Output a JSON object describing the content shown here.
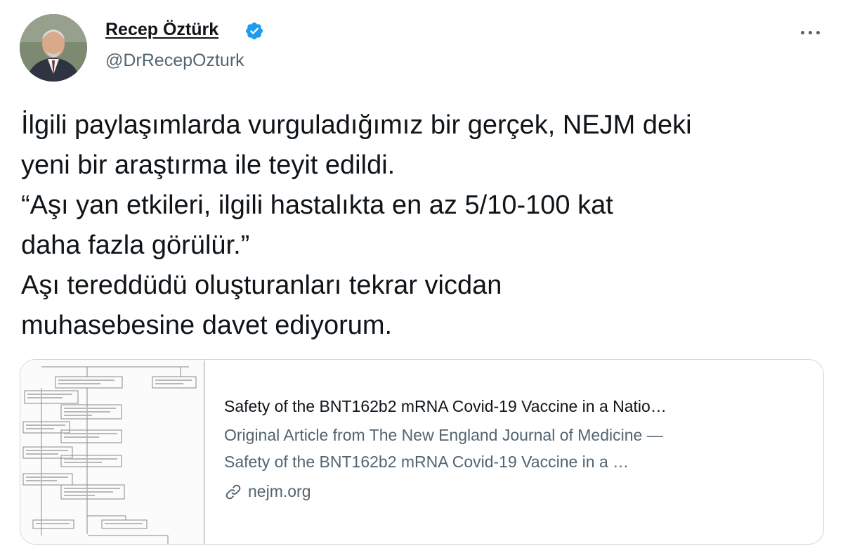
{
  "author": {
    "name": "Recep Öztürk",
    "handle": "@DrRecepOzturk",
    "verified": true,
    "avatar_icon": "profile-photo"
  },
  "menu": {
    "icon": "more-options-icon"
  },
  "tweet": {
    "lines": [
      "İlgili paylaşımlarda vurguladığımız bir gerçek, NEJM deki",
      "yeni bir araştırma ile teyit edildi.",
      "“Aşı yan etkileri, ilgili hastalıkta en az 5/10-100 kat",
      "daha fazla görülür.”",
      "Aşı tereddüdü oluşturanları tekrar vicdan",
      "muhasebesine davet ediyorum."
    ]
  },
  "card": {
    "title": "Safety of the BNT162b2 mRNA Covid-19 Vaccine in a Natio…",
    "description_lines": [
      "Original Article from The New England Journal of Medicine —",
      "Safety of the BNT162b2 mRNA Covid-19 Vaccine in a …"
    ],
    "domain": "nejm.org",
    "domain_icon": "link-icon",
    "thumbnail": "flowchart-thumbnail"
  },
  "colors": {
    "text": "#0f1419",
    "secondary": "#536471",
    "verified": "#1d9bf0",
    "border": "#cfd9de"
  }
}
